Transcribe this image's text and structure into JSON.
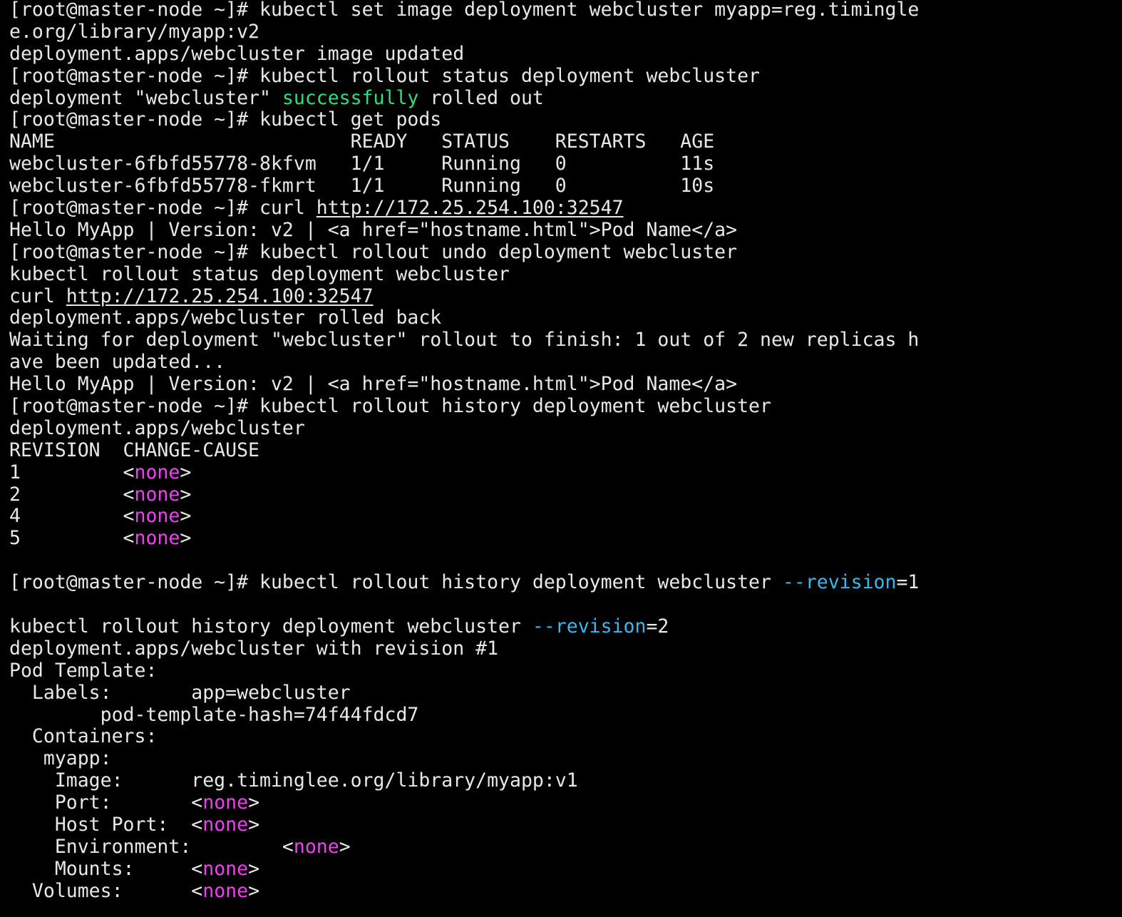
{
  "colors": {
    "background": "#000000",
    "text": "#e8e8e8",
    "green": "#2fe07a",
    "magenta": "#ef41ef",
    "cyan": "#38b8ee"
  },
  "lines": [
    [
      {
        "t": "[root@master-node ~]# kubectl set image deployment webcluster myapp=reg.timingle"
      }
    ],
    [
      {
        "t": "e.org/library/myapp:v2"
      }
    ],
    [
      {
        "t": "deployment.apps/webcluster image updated"
      }
    ],
    [
      {
        "t": "[root@master-node ~]# kubectl rollout status deployment webcluster"
      }
    ],
    [
      {
        "t": "deployment \"webcluster\" "
      },
      {
        "t": "successfully",
        "s": "green"
      },
      {
        "t": " rolled out"
      }
    ],
    [
      {
        "t": "[root@master-node ~]# kubectl get pods"
      }
    ],
    [
      {
        "t": "NAME                          READY   STATUS    RESTARTS   AGE"
      }
    ],
    [
      {
        "t": "webcluster-6fbfd55778-8kfvm   1/1     Running   0          11s"
      }
    ],
    [
      {
        "t": "webcluster-6fbfd55778-fkmrt   1/1     Running   0          10s"
      }
    ],
    [
      {
        "t": "[root@master-node ~]# curl "
      },
      {
        "t": "http://172.25.254.100:32547",
        "s": "link"
      }
    ],
    [
      {
        "t": "Hello MyApp | Version: v2 | <a href=\"hostname.html\">Pod Name</a>"
      }
    ],
    [
      {
        "t": "[root@master-node ~]# kubectl rollout undo deployment webcluster"
      }
    ],
    [
      {
        "t": "kubectl rollout status deployment webcluster"
      }
    ],
    [
      {
        "t": "curl "
      },
      {
        "t": "http://172.25.254.100:32547",
        "s": "link"
      }
    ],
    [
      {
        "t": "deployment.apps/webcluster rolled back"
      }
    ],
    [
      {
        "t": "Waiting for deployment \"webcluster\" rollout to finish: 1 out of 2 new replicas h"
      }
    ],
    [
      {
        "t": "ave been updated..."
      }
    ],
    [
      {
        "t": "Hello MyApp | Version: v2 | <a href=\"hostname.html\">Pod Name</a>"
      }
    ],
    [
      {
        "t": "[root@master-node ~]# kubectl rollout history deployment webcluster"
      }
    ],
    [
      {
        "t": "deployment.apps/webcluster"
      }
    ],
    [
      {
        "t": "REVISION  CHANGE-CAUSE"
      }
    ],
    [
      {
        "t": "1         <"
      },
      {
        "t": "none",
        "s": "magenta"
      },
      {
        "t": ">"
      }
    ],
    [
      {
        "t": "2         <"
      },
      {
        "t": "none",
        "s": "magenta"
      },
      {
        "t": ">"
      }
    ],
    [
      {
        "t": "4         <"
      },
      {
        "t": "none",
        "s": "magenta"
      },
      {
        "t": ">"
      }
    ],
    [
      {
        "t": "5         <"
      },
      {
        "t": "none",
        "s": "magenta"
      },
      {
        "t": ">"
      }
    ],
    [
      {
        "t": ""
      }
    ],
    [
      {
        "t": "[root@master-node ~]# kubectl rollout history deployment webcluster "
      },
      {
        "t": "--revision",
        "s": "cyan"
      },
      {
        "t": "=1"
      }
    ],
    [
      {
        "t": ""
      }
    ],
    [
      {
        "t": "kubectl rollout history deployment webcluster "
      },
      {
        "t": "--revision",
        "s": "cyan"
      },
      {
        "t": "=2"
      }
    ],
    [
      {
        "t": "deployment.apps/webcluster with revision #1"
      }
    ],
    [
      {
        "t": "Pod Template:"
      }
    ],
    [
      {
        "t": "  Labels:       app=webcluster"
      }
    ],
    [
      {
        "t": "        pod-template-hash=74f44fdcd7"
      }
    ],
    [
      {
        "t": "  Containers:"
      }
    ],
    [
      {
        "t": "   myapp:"
      }
    ],
    [
      {
        "t": "    Image:      reg.timinglee.org/library/myapp:v1"
      }
    ],
    [
      {
        "t": "    Port:       <"
      },
      {
        "t": "none",
        "s": "magenta"
      },
      {
        "t": ">"
      }
    ],
    [
      {
        "t": "    Host Port:  <"
      },
      {
        "t": "none",
        "s": "magenta"
      },
      {
        "t": ">"
      }
    ],
    [
      {
        "t": "    Environment:        <"
      },
      {
        "t": "none",
        "s": "magenta"
      },
      {
        "t": ">"
      }
    ],
    [
      {
        "t": "    Mounts:     <"
      },
      {
        "t": "none",
        "s": "magenta"
      },
      {
        "t": ">"
      }
    ],
    [
      {
        "t": "  Volumes:      <"
      },
      {
        "t": "none",
        "s": "magenta"
      },
      {
        "t": ">"
      }
    ]
  ]
}
